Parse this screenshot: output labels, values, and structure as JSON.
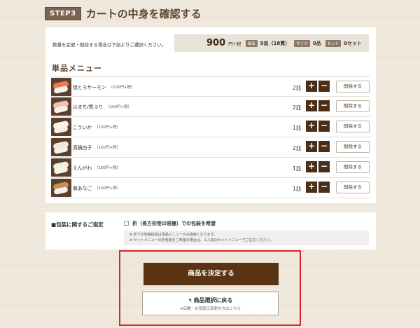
{
  "step": {
    "badge": "STEP3",
    "title": "カートの中身を確認する"
  },
  "summary": {
    "note": "数量を変更・削除する場合は下記よりご選択ください。",
    "total_price": "900",
    "total_suffix": "円+税",
    "single_tag": "単品",
    "single_value": "9皿",
    "single_count": "（18貫）",
    "side_tag": "サイド",
    "side_value": "0品",
    "set_tag": "セット",
    "set_value": "0セット"
  },
  "section_title": "単品メニュー",
  "items": [
    {
      "name": "焼とろサーモン",
      "price": "（100円+税）",
      "qty": "2皿",
      "plus": "+",
      "minus": "−",
      "delete": "削除する",
      "fish_color": "#f07b4f"
    },
    {
      "name": "はまち/寒ぶり",
      "price": "（100円+税）",
      "qty": "2皿",
      "plus": "+",
      "minus": "−",
      "delete": "削除する",
      "fish_color": "#f2c0b5"
    },
    {
      "name": "こういか",
      "price": "（100円+税）",
      "qty": "1皿",
      "plus": "+",
      "minus": "−",
      "delete": "削除する",
      "fish_color": "#f8f5ef"
    },
    {
      "name": "真鯛白子",
      "price": "（100円+税）",
      "qty": "2皿",
      "plus": "+",
      "minus": "−",
      "delete": "削除する",
      "fish_color": "#efe9de"
    },
    {
      "name": "えんがわ",
      "price": "（100円+税）",
      "qty": "1皿",
      "plus": "+",
      "minus": "−",
      "delete": "削除する",
      "fish_color": "#f3ede4"
    },
    {
      "name": "煮あなご",
      "price": "（100円+税）",
      "qty": "1皿",
      "plus": "+",
      "minus": "−",
      "delete": "削除する",
      "fish_color": "#c8904f"
    }
  ],
  "wrapping": {
    "label": "■包装に関するご指定",
    "option": "折（長方形型の容器）での包装を希望",
    "notes": [
      "※ 折での包装指定は単品メニューのみ適用となります。",
      "※ セットメニューの折包装をご希望の場合は、１人前のセットメニューでご注文ください。"
    ]
  },
  "actions": {
    "confirm": "商品を決定する",
    "back": "商品選択に戻る",
    "back_sub": "※店舗・お受取日変更の方はこちら",
    "back_icon": "↰"
  },
  "colors": {
    "accent": "#5a3412",
    "highlight_border": "#d9252b",
    "background": "#efe7d9"
  }
}
